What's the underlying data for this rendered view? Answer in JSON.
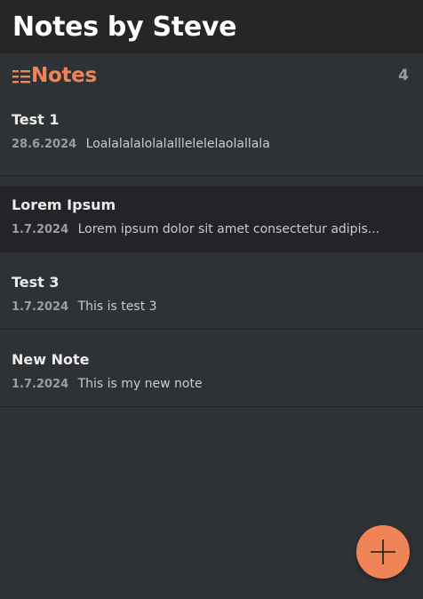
{
  "app": {
    "title": "Notes by Steve"
  },
  "section": {
    "title": "Notes",
    "count": "4",
    "accent_color": "#f08457",
    "icon": "list-icon"
  },
  "notes": [
    {
      "title": "Test 1",
      "date": "28.6.2024",
      "preview": "Loalalalalolalalllelelelaolallala",
      "selected": false
    },
    {
      "title": "Lorem Ipsum",
      "date": "1.7.2024",
      "preview": "Lorem ipsum dolor sit amet consectetur adipis...",
      "selected": true
    },
    {
      "title": "Test 3",
      "date": "1.7.2024",
      "preview": "This is test 3",
      "selected": false
    },
    {
      "title": "New Note",
      "date": "1.7.2024",
      "preview": "This is my new note",
      "selected": false
    }
  ],
  "fab": {
    "icon": "plus-icon",
    "color": "#f08457"
  }
}
